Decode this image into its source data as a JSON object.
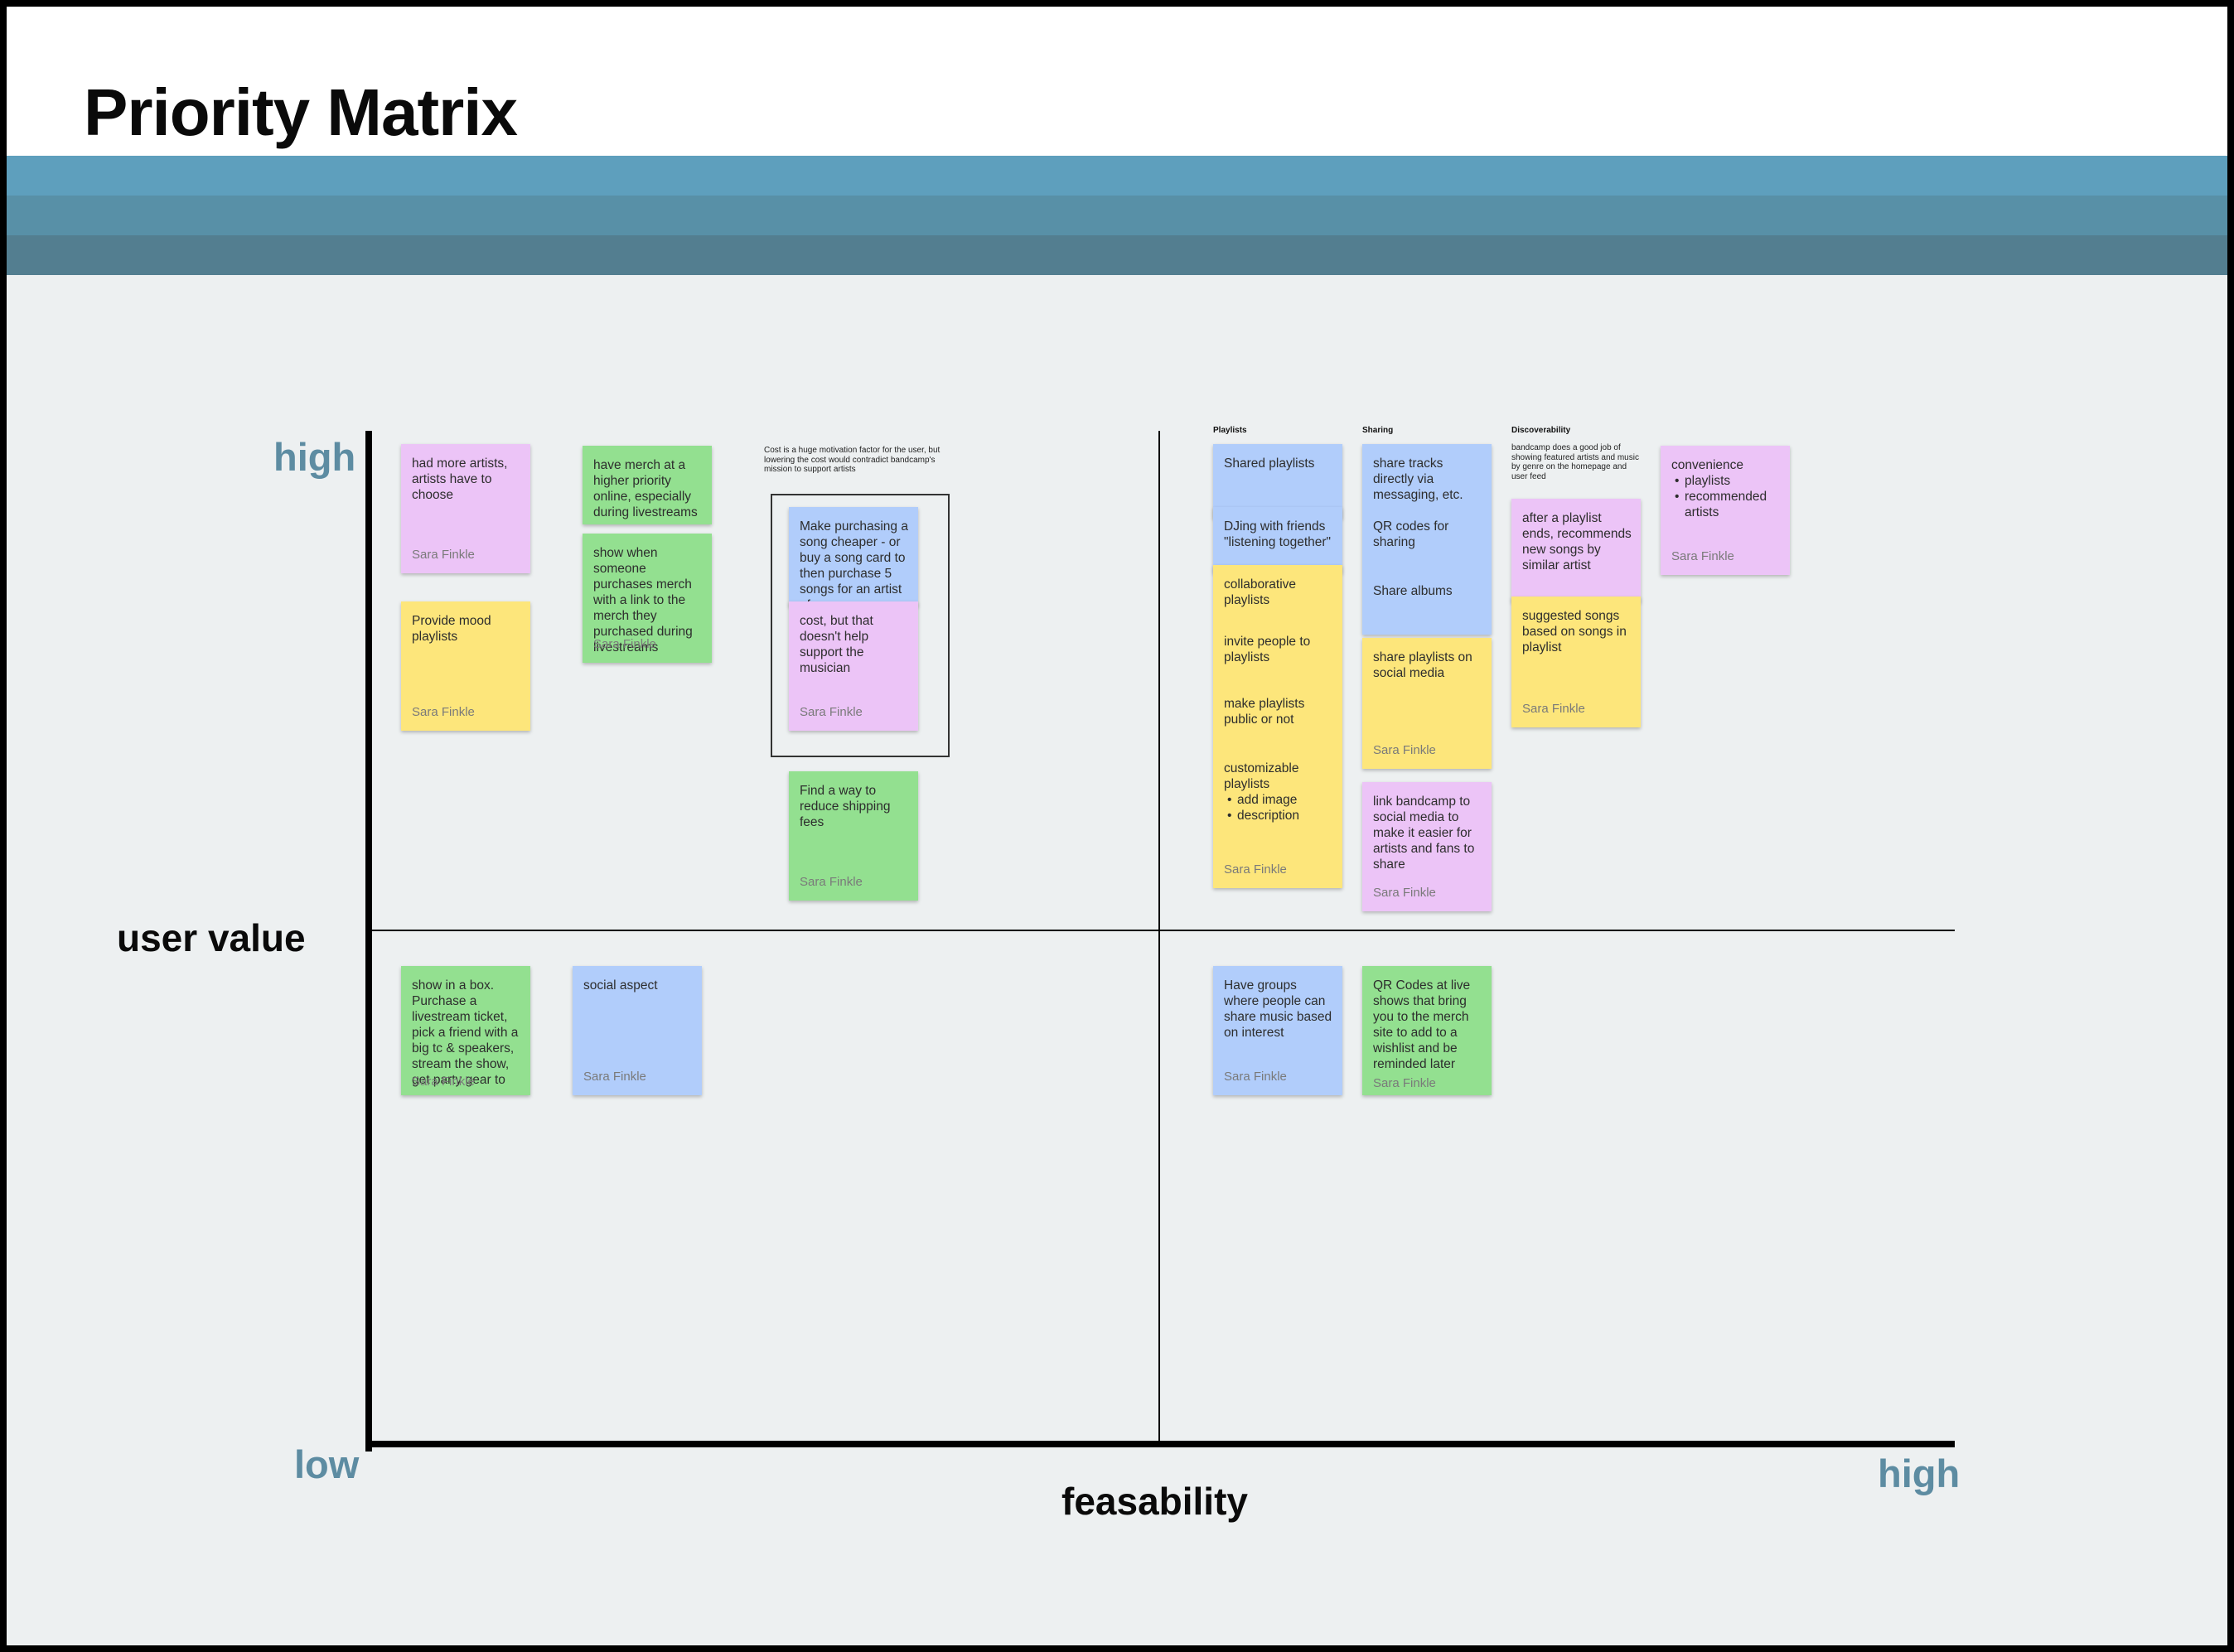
{
  "title": "Priority Matrix",
  "axes": {
    "y_high": "high",
    "y_title": "user value",
    "x_low": "low",
    "x_title": "feasability",
    "x_high": "high"
  },
  "colors": {
    "band_top": "#5e9fbd",
    "band_mid": "#5890a7",
    "band_bottom": "#537e90",
    "axis_word": "#5d8ca2",
    "sticky_pink": "#ecc4f7",
    "sticky_green": "#93e090",
    "sticky_blue": "#b1cdfb",
    "sticky_yellow": "#fde67b"
  },
  "author": "Sara Finkle",
  "cluster_headings": {
    "playlists": "Playlists",
    "sharing": "Sharing",
    "discoverability": "Discoverability"
  },
  "comments": {
    "cost": "Cost is a huge motivation factor for the user, but lowering the cost would contradict bandcamp's mission to support artists",
    "discoverability": "bandcamp does a good job of showing featured artists and music by genre on the homepage and user feed"
  },
  "notes": {
    "more_artists": "had more artists, artists have to choose",
    "mood_playlists": "Provide mood playlists",
    "merch_priority": "have merch at a higher priority online, especially during livestreams",
    "merch_link": "show when someone purchases merch with a link to the merch they purchased during livestreams",
    "cheaper_song": "Make purchasing a song cheaper - or buy a song card to then purchase 5 songs for an artist of",
    "cost_musician": "cost, but that doesn't help support the musician",
    "shipping": "Find a way to reduce shipping fees",
    "shared_playlists": "Shared playlists",
    "djing": "DJing with friends \"listening together\"",
    "collaborative": "collaborative playlists",
    "invite": "invite people to playlists",
    "public": "make playlists public or not",
    "customizable": "customizable playlists",
    "customizable_items": [
      "add image",
      "description"
    ],
    "share_tracks": "share tracks directly via messaging, etc.",
    "qr_sharing": "QR codes for sharing",
    "share_albums": "Share albums",
    "share_social": "share playlists on social media",
    "link_social": "link bandcamp to social media to make it easier for artists and fans to share",
    "after_playlist": "after a playlist ends, recommends new songs by similar artist",
    "suggested": "suggested songs based on songs in playlist",
    "convenience": "convenience",
    "convenience_items": [
      "playlists",
      "recommended artists"
    ],
    "show_in_box": "show in a box. Purchase a livestream ticket, pick a friend with a big tc & speakers, stream the show, get party gear to",
    "social_aspect": "social aspect",
    "groups": "Have groups where people can share music based on interest",
    "qr_live": "QR Codes at live shows that bring you to the merch site to add to a wishlist and be reminded later"
  }
}
